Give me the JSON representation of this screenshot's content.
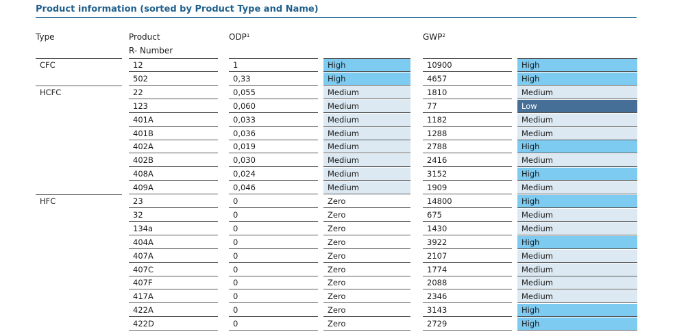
{
  "title": "Product information (sorted by Product Type and Name)",
  "headers": {
    "type": "Type",
    "product_line1": "Product",
    "product_line2": "R- Number",
    "odp": "ODP",
    "odp_sup": "1",
    "gwp": "GWP",
    "gwp_sup": "2"
  },
  "colors": {
    "title": "#1f5f8b",
    "high": "#7ecbf1",
    "medium": "#dce9f2",
    "low": "#456f96",
    "zero": "#ffffff"
  },
  "rows": [
    {
      "type": "CFC",
      "product": "12",
      "odp": "1",
      "odp_class": "High",
      "gwp": "10900",
      "gwp_class": "High"
    },
    {
      "type": "",
      "product": "502",
      "odp": "0,33",
      "odp_class": "High",
      "gwp": "4657",
      "gwp_class": "High"
    },
    {
      "type": "HCFC",
      "product": "22",
      "odp": "0,055",
      "odp_class": "Medium",
      "gwp": "1810",
      "gwp_class": "Medium"
    },
    {
      "type": "",
      "product": "123",
      "odp": "0,060",
      "odp_class": "Medium",
      "gwp": "77",
      "gwp_class": "Low"
    },
    {
      "type": "",
      "product": "401A",
      "odp": "0,033",
      "odp_class": "Medium",
      "gwp": "1182",
      "gwp_class": "Medium"
    },
    {
      "type": "",
      "product": "401B",
      "odp": "0,036",
      "odp_class": "Medium",
      "gwp": "1288",
      "gwp_class": "Medium"
    },
    {
      "type": "",
      "product": "402A",
      "odp": "0,019",
      "odp_class": "Medium",
      "gwp": "2788",
      "gwp_class": "High"
    },
    {
      "type": "",
      "product": "402B",
      "odp": "0,030",
      "odp_class": "Medium",
      "gwp": "2416",
      "gwp_class": "Medium"
    },
    {
      "type": "",
      "product": "408A",
      "odp": "0,024",
      "odp_class": "Medium",
      "gwp": "3152",
      "gwp_class": "High"
    },
    {
      "type": "",
      "product": "409A",
      "odp": "0,046",
      "odp_class": "Medium",
      "gwp": "1909",
      "gwp_class": "Medium"
    },
    {
      "type": "HFC",
      "product": "23",
      "odp": "0",
      "odp_class": "Zero",
      "gwp": "14800",
      "gwp_class": "High"
    },
    {
      "type": "",
      "product": "32",
      "odp": "0",
      "odp_class": "Zero",
      "gwp": "675",
      "gwp_class": "Medium"
    },
    {
      "type": "",
      "product": "134a",
      "odp": "0",
      "odp_class": "Zero",
      "gwp": "1430",
      "gwp_class": "Medium"
    },
    {
      "type": "",
      "product": "404A",
      "odp": "0",
      "odp_class": "Zero",
      "gwp": "3922",
      "gwp_class": "High"
    },
    {
      "type": "",
      "product": "407A",
      "odp": "0",
      "odp_class": "Zero",
      "gwp": "2107",
      "gwp_class": "Medium"
    },
    {
      "type": "",
      "product": "407C",
      "odp": "0",
      "odp_class": "Zero",
      "gwp": "1774",
      "gwp_class": "Medium"
    },
    {
      "type": "",
      "product": "407F",
      "odp": "0",
      "odp_class": "Zero",
      "gwp": "2088",
      "gwp_class": "Medium"
    },
    {
      "type": "",
      "product": "417A",
      "odp": "0",
      "odp_class": "Zero",
      "gwp": "2346",
      "gwp_class": "Medium"
    },
    {
      "type": "",
      "product": "422A",
      "odp": "0",
      "odp_class": "Zero",
      "gwp": "3143",
      "gwp_class": "High"
    },
    {
      "type": "",
      "product": "422D",
      "odp": "0",
      "odp_class": "Zero",
      "gwp": "2729",
      "gwp_class": "High"
    }
  ]
}
